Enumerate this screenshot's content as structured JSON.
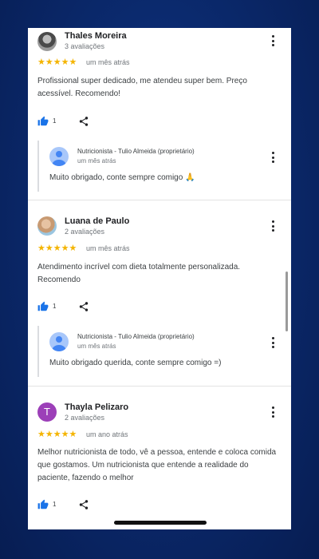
{
  "reviews": [
    {
      "name": "Thales Moreira",
      "reviews_count": "3 avaliações",
      "stars": "★★★★★",
      "time": "um mês atrás",
      "text": "Profissional super dedicado, me atendeu super bem. Preço acessível. Recomendo!",
      "likes": "1",
      "reply": {
        "author": "Nutricionista - Tulio Almeida (proprietário)",
        "time": "um mês atrás",
        "text": "Muito obrigado, conte sempre comigo 🙏"
      }
    },
    {
      "name": "Luana de Paulo",
      "reviews_count": "2 avaliações",
      "stars": "★★★★★",
      "time": "um mês atrás",
      "text": "Atendimento incrível com dieta totalmente personalizada. Recomendo",
      "likes": "1",
      "reply": {
        "author": "Nutricionista - Tulio Almeida (proprietário)",
        "time": "um mês atrás",
        "text": "Muito obrigado querida, conte sempre comigo =)"
      }
    },
    {
      "name": "Thayla Pelizaro",
      "avatar_letter": "T",
      "reviews_count": "2 avaliações",
      "stars": "★★★★★",
      "time": "um ano atrás",
      "text": "Melhor nutricionista de todo, vê a pessoa, entende e coloca comida que gostamos. Um nutricionista que entende a realidade do paciente, fazendo o melhor",
      "likes": "1"
    }
  ],
  "colors": {
    "star": "#f4b400",
    "like_icon": "#1a73e8",
    "letter_avatar": "#9c3fb8",
    "background": "#0b2a6e"
  },
  "icons": [
    "thumbs-up-icon",
    "share-icon",
    "more-vert-icon",
    "person-icon"
  ]
}
